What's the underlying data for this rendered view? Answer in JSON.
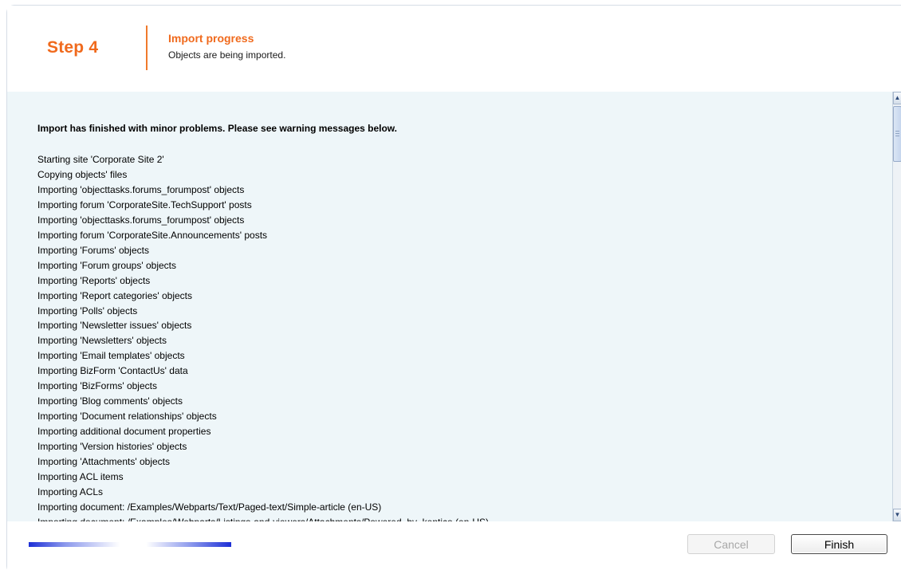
{
  "header": {
    "step": "Step 4",
    "title": "Import progress",
    "subtitle": "Objects are being imported."
  },
  "log": {
    "summary": "Import has finished with minor problems. Please see warning messages below.",
    "lines": [
      "Starting site 'Corporate Site 2'",
      "Copying objects' files",
      "Importing 'objecttasks.forums_forumpost' objects",
      "Importing forum 'CorporateSite.TechSupport' posts",
      "Importing 'objecttasks.forums_forumpost' objects",
      "Importing forum 'CorporateSite.Announcements' posts",
      "Importing 'Forums' objects",
      "Importing 'Forum groups' objects",
      "Importing 'Reports' objects",
      "Importing 'Report categories' objects",
      "Importing 'Polls' objects",
      "Importing 'Newsletter issues' objects",
      "Importing 'Newsletters' objects",
      "Importing 'Email templates' objects",
      "Importing BizForm 'ContactUs' data",
      "Importing 'BizForms' objects",
      "Importing 'Blog comments' objects",
      "Importing 'Document relationships' objects",
      "Importing additional document properties",
      "Importing 'Version histories' objects",
      "Importing 'Attachments' objects",
      "Importing ACL items",
      "Importing ACLs",
      "Importing document: /Examples/Webparts/Text/Paged-text/Simple-article (en-US)",
      "Importing document: /Examples/Webparts/Listings-and-viewers/Attachments/Powered_by_kentico (en-US)"
    ]
  },
  "footer": {
    "cancel_label": "Cancel",
    "finish_label": "Finish"
  },
  "colors": {
    "accent": "#f06a1d",
    "panel_bg": "#eef6f9",
    "progress": "#1d2fd6"
  }
}
